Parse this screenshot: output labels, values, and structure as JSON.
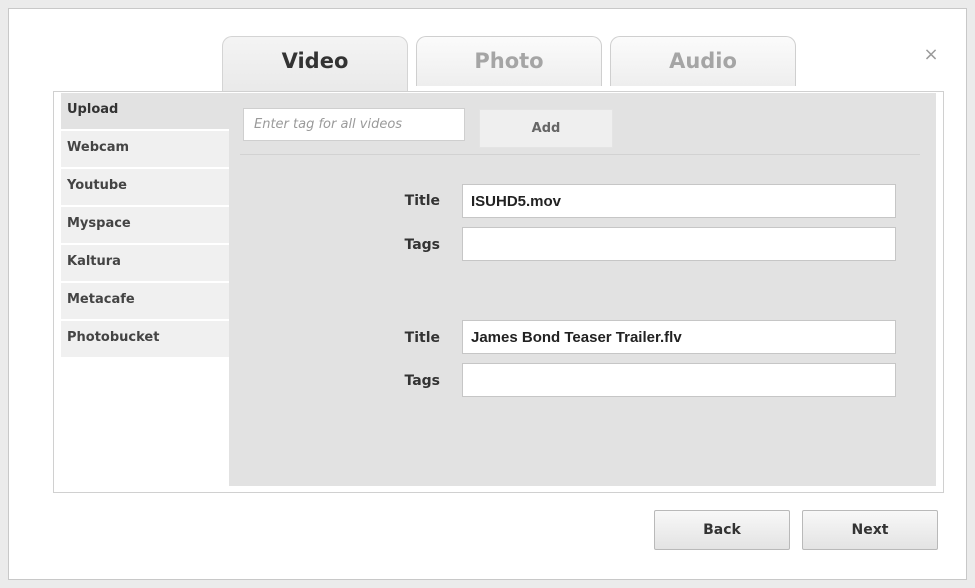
{
  "dialog": {
    "close_label": "×"
  },
  "tabs": [
    {
      "label": "Video",
      "active": true
    },
    {
      "label": "Photo",
      "active": false
    },
    {
      "label": "Audio",
      "active": false
    }
  ],
  "sidebar": {
    "items": [
      {
        "label": "Upload",
        "active": true
      },
      {
        "label": "Webcam",
        "active": false
      },
      {
        "label": "Youtube",
        "active": false
      },
      {
        "label": "Myspace",
        "active": false
      },
      {
        "label": "Kaltura",
        "active": false
      },
      {
        "label": "Metacafe",
        "active": false
      },
      {
        "label": "Photobucket",
        "active": false
      }
    ]
  },
  "tagger": {
    "placeholder": "Enter tag for all videos",
    "value": "",
    "add_label": "Add"
  },
  "videos": [
    {
      "title_label": "Title",
      "title_value": "ISUHD5.mov",
      "tags_label": "Tags",
      "tags_value": ""
    },
    {
      "title_label": "Title",
      "title_value": "James Bond Teaser Trailer.flv",
      "tags_label": "Tags",
      "tags_value": ""
    }
  ],
  "footer": {
    "back_label": "Back",
    "next_label": "Next"
  }
}
